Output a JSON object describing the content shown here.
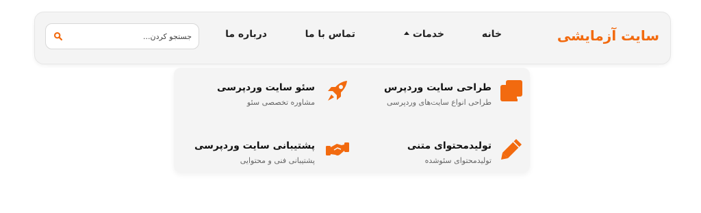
{
  "header": {
    "brand": "سایت آزمایشی",
    "nav": [
      {
        "label": "خانه"
      },
      {
        "label": "خدمات"
      },
      {
        "label": "تماس با ما"
      },
      {
        "label": "درباره ما"
      }
    ],
    "search": {
      "placeholder": "جستجو کردن...",
      "value": "",
      "icon": "search-icon"
    }
  },
  "services_menu": {
    "items": [
      {
        "title": "طراحی سایت وردپرس",
        "subtitle": "طراحی انواع سایت‌های وردپرسی",
        "icon": "copy-icon"
      },
      {
        "title": "سئو سایت وردپرسی",
        "subtitle": "مشاوره تخصصی سئو",
        "icon": "rocket-icon"
      },
      {
        "title": "تولیدمحتوای متنی",
        "subtitle": "تولیدمحتوای سئوشده",
        "icon": "pencil-icon"
      },
      {
        "title": "پشتیبانی سایت وردپرسی",
        "subtitle": "پشتیبانی فنی و محتوایی",
        "icon": "handshake-icon"
      }
    ]
  },
  "colors": {
    "accent": "#f26a0f",
    "text": "#222222",
    "subtext": "#666666",
    "panel": "#f4f4f4"
  }
}
